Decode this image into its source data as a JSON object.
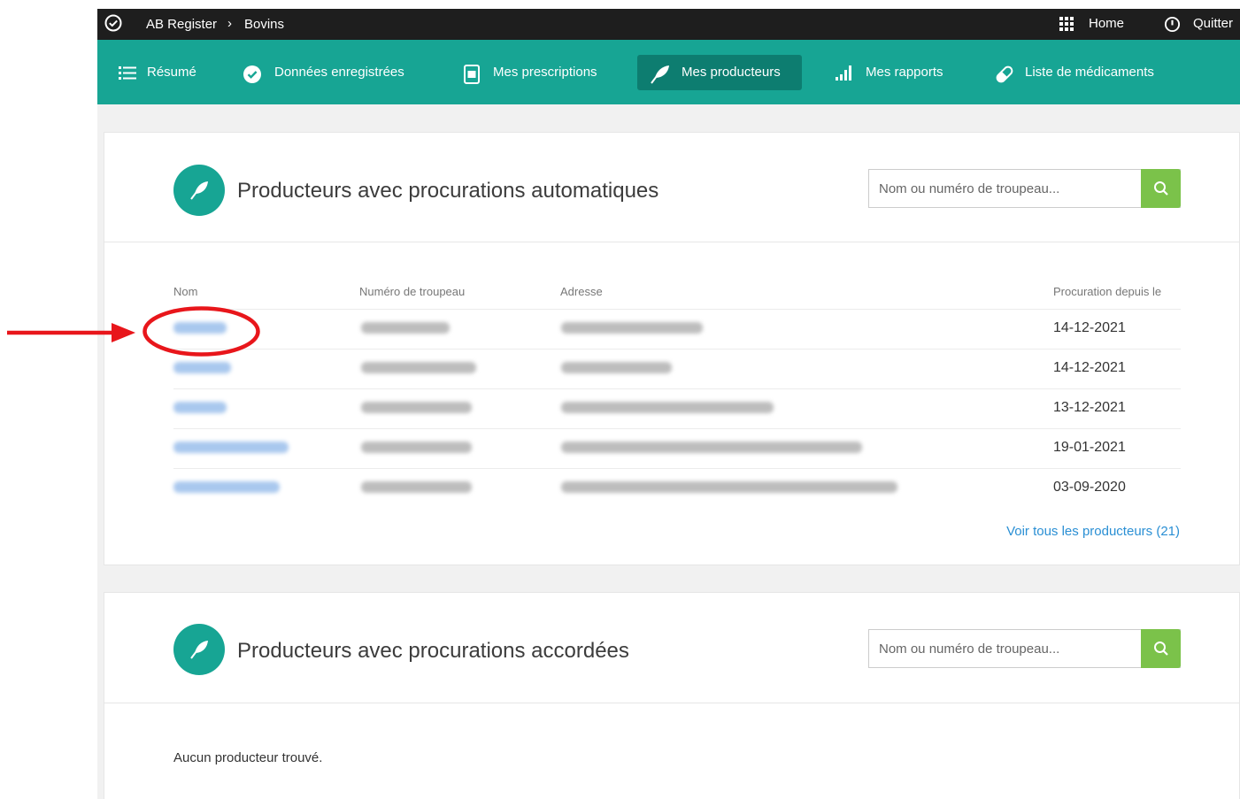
{
  "topbar": {
    "app_name": "AB Register",
    "separator": "›",
    "breadcrumb": "Bovins",
    "home_label": "Home",
    "quit_label": "Quitter",
    "icons": [
      "check-circle-icon",
      "grid-icon",
      "power-icon"
    ]
  },
  "nav": {
    "items": [
      {
        "label": "Résumé",
        "icon": "list-icon"
      },
      {
        "label": "Données enregistrées",
        "icon": "check-circle-icon"
      },
      {
        "label": "Mes prescriptions",
        "icon": "document-icon"
      },
      {
        "label": "Mes producteurs",
        "icon": "feather-icon",
        "active": true
      },
      {
        "label": "Mes rapports",
        "icon": "bar-chart-icon"
      },
      {
        "label": "Liste de médicaments",
        "icon": "pill-icon"
      }
    ]
  },
  "auto_section": {
    "title": "Producteurs avec procurations automatiques",
    "search_placeholder": "Nom ou numéro de troupeau...",
    "columns": {
      "name": "Nom",
      "herd_number": "Numéro de troupeau",
      "address": "Adresse",
      "since": "Procuration depuis le"
    },
    "rows": [
      {
        "since": "14-12-2021"
      },
      {
        "since": "14-12-2021"
      },
      {
        "since": "13-12-2021"
      },
      {
        "since": "19-01-2021"
      },
      {
        "since": "03-09-2020"
      }
    ],
    "see_all": "Voir tous les producteurs (21)"
  },
  "granted_section": {
    "title": "Producteurs avec procurations accordées",
    "search_placeholder": "Nom ou numéro de troupeau...",
    "empty_text": "Aucun producteur trouvé."
  },
  "colors": {
    "teal": "#17a594",
    "teal_active": "#0d7d70",
    "search_green": "#7bc24a",
    "link_blue": "#2a8fd4",
    "annotation_red": "#e8161b"
  }
}
